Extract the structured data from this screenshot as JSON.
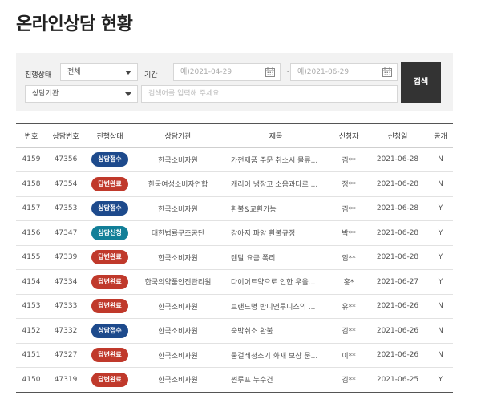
{
  "page": {
    "title": "온라인상담 현황"
  },
  "filters": {
    "status_label": "진행상태",
    "status_value": "전체",
    "period_label": "기간",
    "date_from_placeholder": "예)2021-04-29",
    "date_separator": "~",
    "date_to_placeholder": "예)2021-06-29",
    "agency_value": "상담기관",
    "keyword_placeholder": "검색어를 입력해 주세요",
    "search_label": "검색"
  },
  "table": {
    "headers": [
      "번호",
      "상담번호",
      "진행상태",
      "상담기관",
      "제목",
      "신청자",
      "신청일",
      "공개"
    ],
    "rows": [
      {
        "no": "4159",
        "case_no": "47356",
        "status": "상담접수",
        "status_type": "receipt",
        "agency": "한국소비자원",
        "title": "가전제품 주문 취소시 물류...",
        "applicant": "김**",
        "date": "2021-06-28",
        "public": "N"
      },
      {
        "no": "4158",
        "case_no": "47354",
        "status": "답변완료",
        "status_type": "done",
        "agency": "한국여성소비자연합",
        "title": "캐리어 냉장고 소음과다로 ...",
        "applicant": "정**",
        "date": "2021-06-28",
        "public": "N"
      },
      {
        "no": "4157",
        "case_no": "47353",
        "status": "상담접수",
        "status_type": "receipt",
        "agency": "한국소비자원",
        "title": "환불&교환가능",
        "applicant": "김**",
        "date": "2021-06-28",
        "public": "Y"
      },
      {
        "no": "4156",
        "case_no": "47347",
        "status": "상담신청",
        "status_type": "apply",
        "agency": "대한법률구조공단",
        "title": "강아지 파양 환불규정",
        "applicant": "박**",
        "date": "2021-06-28",
        "public": "Y"
      },
      {
        "no": "4155",
        "case_no": "47339",
        "status": "답변완료",
        "status_type": "done",
        "agency": "한국소비자원",
        "title": "렌탈 요금 폭리",
        "applicant": "임**",
        "date": "2021-06-28",
        "public": "Y"
      },
      {
        "no": "4154",
        "case_no": "47334",
        "status": "답변완료",
        "status_type": "done",
        "agency": "한국의약품안전관리원",
        "title": "다이어트약으로 인한 우울...",
        "applicant": "홍*",
        "date": "2021-06-27",
        "public": "Y"
      },
      {
        "no": "4153",
        "case_no": "47333",
        "status": "답변완료",
        "status_type": "done",
        "agency": "한국소비자원",
        "title": "브랜드명 반디앤루니스의 ...",
        "applicant": "유**",
        "date": "2021-06-26",
        "public": "N"
      },
      {
        "no": "4152",
        "case_no": "47332",
        "status": "상담접수",
        "status_type": "receipt",
        "agency": "한국소비자원",
        "title": "숙박취소 환불",
        "applicant": "김**",
        "date": "2021-06-26",
        "public": "N"
      },
      {
        "no": "4151",
        "case_no": "47327",
        "status": "답변완료",
        "status_type": "done",
        "agency": "한국소비자원",
        "title": "물걸레청소기 화재 보상 문...",
        "applicant": "이**",
        "date": "2021-06-26",
        "public": "N"
      },
      {
        "no": "4150",
        "case_no": "47319",
        "status": "답변완료",
        "status_type": "done",
        "agency": "한국소비자원",
        "title": "썬루프 누수건",
        "applicant": "김**",
        "date": "2021-06-25",
        "public": "Y"
      }
    ]
  },
  "icons": {
    "date_picker": "calendar-icon",
    "select_arrow": "chevron-down-icon"
  },
  "colors": {
    "receipt": "#1d4a8c",
    "done": "#c0392b",
    "apply": "#127f98",
    "public_n": "#e2542a",
    "public_y": "#6a8a2a"
  }
}
